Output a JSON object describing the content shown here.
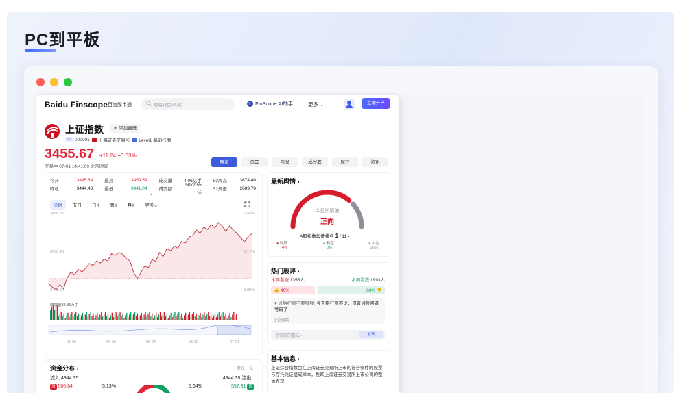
{
  "page": {
    "title": "PC到平板"
  },
  "window": {
    "dots": [
      "close",
      "minimize",
      "maximize"
    ]
  },
  "header": {
    "logo": "Baidu Finscope",
    "logo_sub": "百度股市通",
    "search_placeholder": "股票代码/名称",
    "ai_label": "FinScope AI助手",
    "more_label": "更多",
    "open_account": "立即开户"
  },
  "stock": {
    "name": "上证指数",
    "watch_label": "添加自选",
    "market_tag": "SZ",
    "code": "000001",
    "exchange": "上海证券交易所",
    "level": "Level1 基础行情",
    "price": "3455.67",
    "change": "+11.24",
    "change_pct": "+0.33%",
    "status": "交易中 07-01 14:41:00 北京时间"
  },
  "tabs": [
    "概览",
    "资金",
    "简况",
    "成分股",
    "股评",
    "资讯"
  ],
  "stats": {
    "rows": [
      [
        {
          "label": "今开",
          "value": "3445.84",
          "tone": "up"
        },
        {
          "label": "最高",
          "value": "3459.59",
          "tone": "up"
        },
        {
          "label": "成交量",
          "value": "4.06亿手",
          "tone": "flat"
        },
        {
          "label": "52周高",
          "value": "3674.40",
          "tone": "flat"
        }
      ],
      [
        {
          "label": "昨收",
          "value": "3444.43",
          "tone": "flat"
        },
        {
          "label": "最低",
          "value": "3441.04",
          "tone": "down"
        },
        {
          "label": "成交额",
          "value": "5072.55亿",
          "tone": "flat"
        },
        {
          "label": "52周低",
          "value": "2689.70",
          "tone": "flat"
        }
      ]
    ]
  },
  "periods": [
    "分时",
    "五日",
    "日K",
    "周K",
    "月K",
    "更多"
  ],
  "chart_data": {
    "type": "line",
    "y_labels_left": [
      "3458.35",
      "3450.43",
      "3441.50"
    ],
    "y_labels_right": [
      "0.43%",
      "0.17%",
      "-0.09%"
    ],
    "volume_label": "成交量33.85万手",
    "x_labels": [
      "06-25",
      "06-26",
      "06-27",
      "06-30",
      "07-01"
    ],
    "prev_close": 3444.43,
    "ylim": [
      3441.5,
      3459.6
    ],
    "values": [
      3443.2,
      3442.4,
      3441.8,
      3443.0,
      3442.0,
      3444.6,
      3446.0,
      3445.3,
      3446.6,
      3446.0,
      3446.9,
      3448.0,
      3447.5,
      3448.6,
      3448.1,
      3449.0,
      3448.6,
      3450.3,
      3449.9,
      3450.6,
      3450.2,
      3449.2,
      3448.6,
      3445.9,
      3444.4,
      3445.9,
      3447.4,
      3447.0,
      3448.9,
      3448.5,
      3450.6,
      3449.6,
      3451.5,
      3451.0,
      3452.1,
      3451.6,
      3453.2,
      3452.8,
      3454.2,
      3454.6,
      3455.9,
      3455.1,
      3456.6,
      3456.0,
      3457.2,
      3456.4,
      3457.7,
      3456.8,
      3455.6,
      3456.9,
      3455.9,
      3455.1,
      3454.1,
      3453.1,
      3454.3,
      3455.0
    ]
  },
  "sentiment": {
    "title": "最新舆情",
    "today_label": "今日舆情偏",
    "today_value": "正向",
    "rank_text": "A股指数舆情排名",
    "rank_value": "1",
    "rank_total": "/ 11",
    "bull_label": "利好",
    "bull_pct": "74%",
    "neutral_label": "利空",
    "neutral_pct": "0%",
    "bear_label": "中性",
    "bear_pct": "26%",
    "bull": 0.74,
    "neg": 0.0,
    "neu": 0.26,
    "colors": {
      "bull": "#d41c2c",
      "neg": "#129e63",
      "neu": "#8c9099"
    }
  },
  "hot": {
    "title": "热门股评",
    "bull_text": "本周看涨",
    "bull_count": "1355人",
    "bear_text": "本周看跌",
    "bear_count": "1993人",
    "bull_pct": "40%",
    "bear_pct": "60%",
    "bull_ratio": 0.4,
    "comment_user": "以后护盘不要喊我:",
    "comment_text": "今天银行涨不少，但普通投资者亏麻了",
    "comment_time": "1分钟前",
    "reply_placeholder": "说说你的看法~",
    "send_label": "发表"
  },
  "funds": {
    "title": "资金分布",
    "unit": "单位：亿",
    "inflow_label": "流入",
    "inflow": "4944.35",
    "outflow_value": "4944.35",
    "outflow_label": "流出",
    "big_in": "506.84",
    "big_in_pct": "5.13%",
    "big_out_pct": "5.64%",
    "big_out": "557.31"
  },
  "basic": {
    "title": "基本信息",
    "text": "上证综合指数由在上海证券交易所上市的符合条件的股票与存托凭证组成样本，反映上海证券交易所上市公司的整体表现"
  }
}
